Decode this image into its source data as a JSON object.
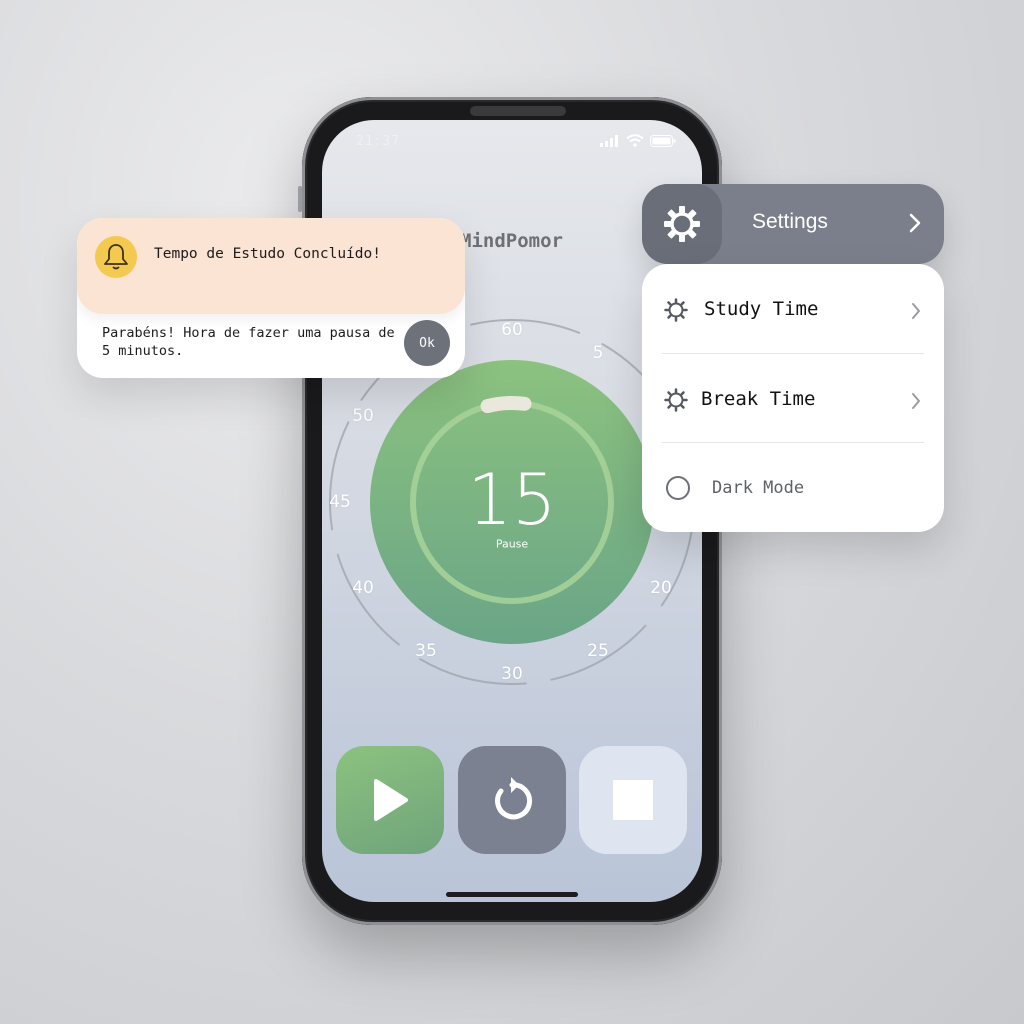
{
  "status_bar": {
    "time": "21:37",
    "icons": [
      "signal-icon",
      "wifi-icon",
      "battery-icon"
    ]
  },
  "app": {
    "title": "MindPomor"
  },
  "dial": {
    "labels": [
      {
        "text": "60",
        "minute": 60
      },
      {
        "text": "5",
        "minute": 5
      },
      {
        "text": "20",
        "minute": 20
      },
      {
        "text": "25",
        "minute": 25
      },
      {
        "text": "30",
        "minute": 30
      },
      {
        "text": "35",
        "minute": 35
      },
      {
        "text": "40",
        "minute": 40
      },
      {
        "text": "45",
        "minute": 45
      },
      {
        "text": "50",
        "minute": 50
      }
    ]
  },
  "timer": {
    "value": "15",
    "label": "Pause",
    "progress": 0.06
  },
  "controls": {
    "play_icon": "play-icon",
    "reset_icon": "reset-icon",
    "stop_icon": "stop-icon"
  },
  "notification": {
    "icon": "bell-icon",
    "title": "Tempo de Estudo Concluído!",
    "body": "Parabéns! Hora de fazer uma pausa de 5 minutos.",
    "ok_label": "Ok"
  },
  "settings": {
    "title": "Settings",
    "items": [
      {
        "label": "Study Time",
        "icon": "gear-icon"
      },
      {
        "label": "Break Time",
        "icon": "gear-icon"
      }
    ],
    "dark_mode_label": "Dark Mode"
  },
  "colors": {
    "accent_green": "#7fb67f",
    "notification_bg": "#fce4d4",
    "settings_header": "#7b7f8b",
    "bell": "#f4c94f"
  }
}
